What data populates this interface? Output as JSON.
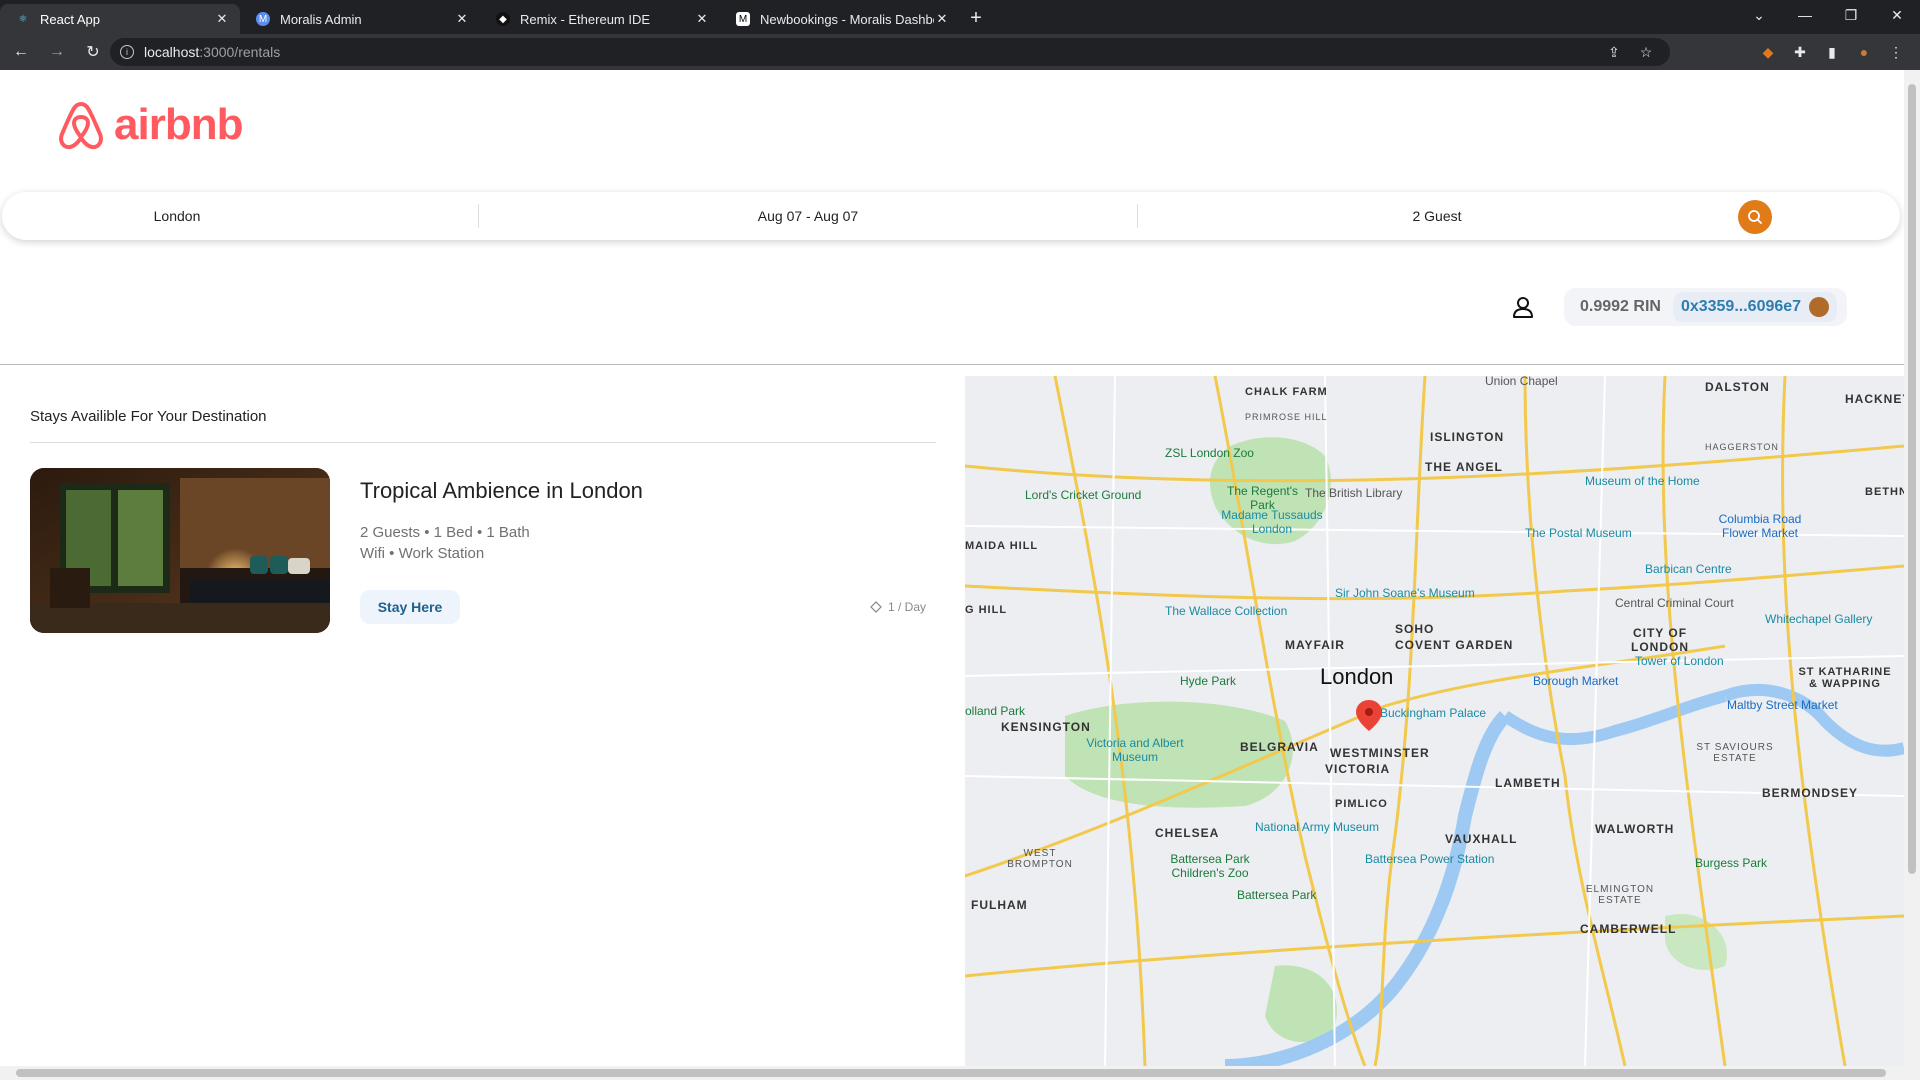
{
  "browser": {
    "tabs": [
      {
        "title": "React App",
        "active": true
      },
      {
        "title": "Moralis Admin",
        "active": false
      },
      {
        "title": "Remix - Ethereum IDE",
        "active": false
      },
      {
        "title": "Newbookings - Moralis Dashboa",
        "active": false
      }
    ],
    "url_host": "localhost",
    "url_path": ":3000/rentals"
  },
  "header": {
    "logo_text": "airbnb"
  },
  "search": {
    "location": "London",
    "dates": "Aug 07 - Aug 07",
    "guests": "2 Guest"
  },
  "account": {
    "balance": "0.9992 RIN",
    "address": "0x3359...6096e7"
  },
  "results": {
    "heading": "Stays Availible For Your Destination",
    "listings": [
      {
        "title": "Tropical Ambience in London",
        "details_line1": "2 Guests • 1 Bed • 1 Bath",
        "details_line2": "Wifi • Work Station",
        "button_label": "Stay Here",
        "price": "1 / Day"
      }
    ]
  },
  "map": {
    "labels": {
      "london": "London",
      "islington": "ISLINGTON",
      "the_angel": "THE ANGEL",
      "dalston": "DALSTON",
      "hackney": "HACKNEY",
      "chalk_farm": "CHALK FARM",
      "primrose_hill": "PRIMROSE HILL",
      "zsl": "ZSL London Zoo",
      "lords": "Lord's Cricket Ground",
      "regents_park": "The Regent's Park",
      "british_library": "The British Library",
      "madame": "Madame Tussauds London",
      "maida_hill": "MAIDA HILL",
      "postal_museum": "The Postal Museum",
      "museum_home": "Museum of the Home",
      "columbia": "Columbia Road Flower Market",
      "barbican": "Barbican Centre",
      "soane": "Sir John Soane's Museum",
      "criminal_court": "Central Criminal Court",
      "wallace": "The Wallace Collection",
      "soho": "SOHO",
      "mayfair": "MAYFAIR",
      "covent_garden": "COVENT GARDEN",
      "city_of_london": "CITY OF LONDON",
      "whitechapel": "Whitechapel Gallery",
      "tower": "Tower of London",
      "st_katharine": "ST KATHARINE & WAPPING",
      "hyde_park": "Hyde Park",
      "borough": "Borough Market",
      "maltby": "Maltby Street Market",
      "holland_park": "olland Park",
      "kensington": "KENSINGTON",
      "buckingham": "Buckingham Palace",
      "va": "Victoria and Albert Museum",
      "belgravia": "BELGRAVIA",
      "westminster": "WESTMINSTER",
      "victoria": "VICTORIA",
      "st_saviours": "ST SAVIOURS ESTATE",
      "lambeth": "LAMBETH",
      "bermondsey": "BERMONDSEY",
      "pimlico": "PIMLICO",
      "national_army": "National Army Museum",
      "chelsea": "CHELSEA",
      "vauxhall": "VAUXHALL",
      "walworth": "WALWORTH",
      "west_brompton": "WEST BROMPTON",
      "battersea_zoo": "Battersea Park Children's Zoo",
      "battersea_power": "Battersea Power Station",
      "burgess_park": "Burgess Park",
      "battersea_park": "Battersea Park",
      "fulham": "FULHAM",
      "elmington": "ELMINGTON ESTATE",
      "camberwell": "CAMBERWELL",
      "union_chapel": "Union Chapel",
      "haggerston": "HAGGERSTON",
      "g_hill": "G HILL",
      "bethn": "BETHN"
    }
  }
}
